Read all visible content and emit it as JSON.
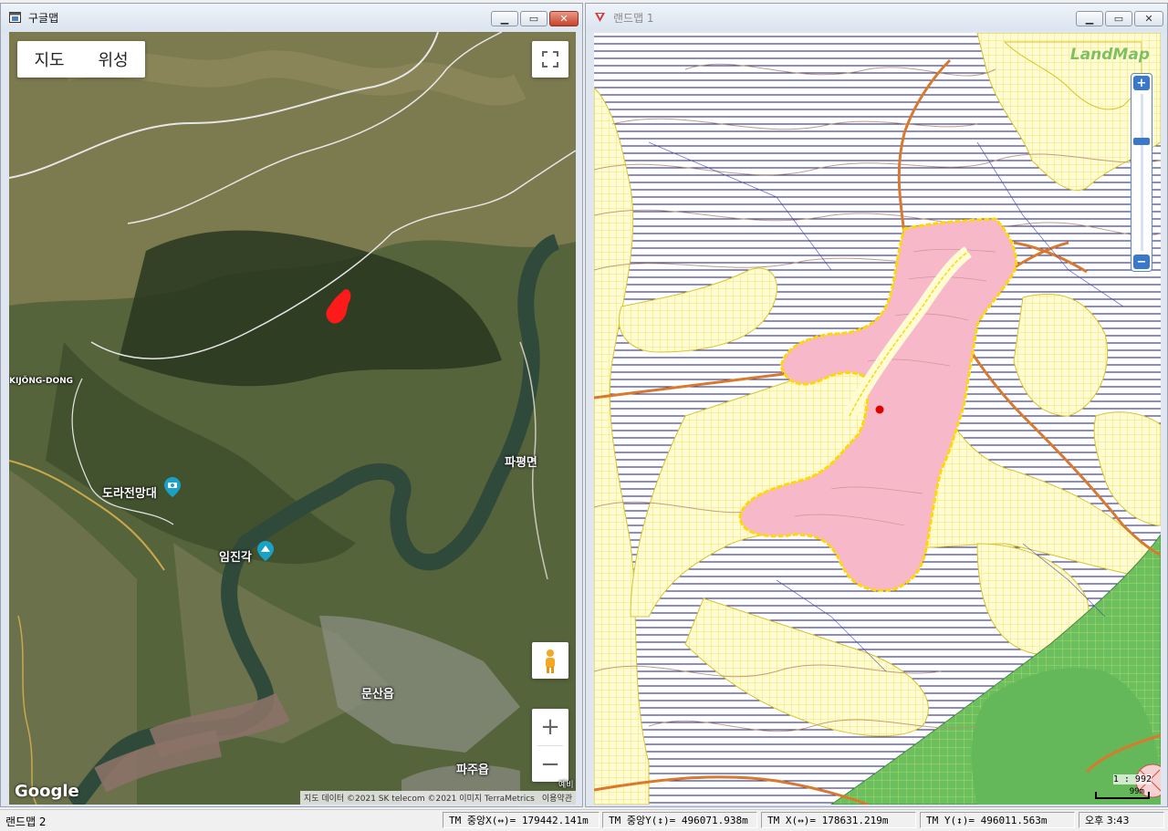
{
  "google_window": {
    "title": "구글맵",
    "icon": "map-window-icon",
    "map_type_tabs": [
      "지도",
      "위성"
    ],
    "fullscreen_icon": "fullscreen-icon",
    "pegman_icon": "pegman-icon",
    "zoom_in": "+",
    "zoom_out": "−",
    "logo": "Google",
    "attribution": "지도 데이터 ©2021 SK telecom ©2021 이미지 TerraMetrics",
    "terms": "이용약관",
    "places": {
      "kijong": "KIJŎNG-DONG",
      "dora": "도라전망대",
      "imjingak": "임진각",
      "papyeong": "파평면",
      "munsan": "문산읍",
      "paju": "파주읍",
      "yebi": "예비"
    },
    "marker_color": "#ff1a1a"
  },
  "landmap_window": {
    "title": "랜드맵 1",
    "icon": "landmap-window-icon",
    "logo": "LandMap",
    "scale_text": "1 : 992",
    "scale_bar_label": "99m",
    "colors": {
      "parcel_fill": "#f7b9c9",
      "parcel_border": "#ffd800",
      "yellow_zone": "#fff9c4",
      "green_zone": "#7cbf6e",
      "road": "#d9792b",
      "hatch": "#1a1a8c",
      "marker": "#e00000"
    }
  },
  "window_buttons": {
    "minimize": "▁",
    "maximize": "▭",
    "close": "✕"
  },
  "status_bar": {
    "app_label": "랜드맵 2",
    "tm_center_x": "TM 중앙X(↔)= 179442.141m",
    "tm_center_y": "TM 중앙Y(↕)= 496071.938m",
    "tm_x": "TM X(↔)= 178631.219m",
    "tm_y": "TM Y(↕)= 496011.563m",
    "time": "오후 3:43"
  }
}
